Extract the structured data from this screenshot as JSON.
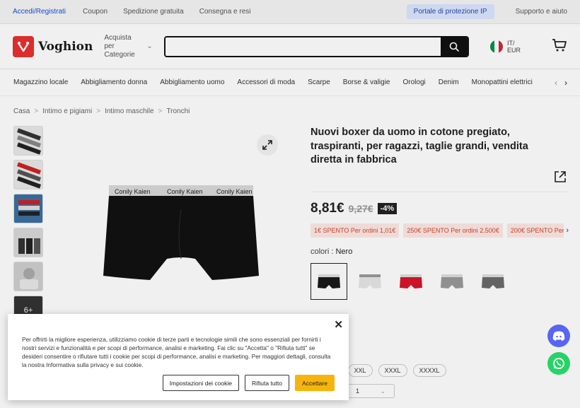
{
  "topbar": {
    "login": "Accedi/Registrati",
    "links": [
      "Coupon",
      "Spedizione gratuita",
      "Consegna e resi"
    ],
    "portal": "Portale di protezione IP",
    "support": "Supporto e aiuto"
  },
  "header": {
    "logo": "Voghion",
    "categories_line1": "Acquista per",
    "categories_line2": "Categorie",
    "search_placeholder": "",
    "lang_line1": "IT/",
    "lang_line2": "EUR"
  },
  "nav": [
    "Magazzino locale",
    "Abbigliamento donna",
    "Abbigliamento uomo",
    "Accessori di moda",
    "Scarpe",
    "Borse & valigie",
    "Orologi",
    "Denim",
    "Monopattini elettrici"
  ],
  "breadcrumb": [
    "Casa",
    "Intimo e pigiami",
    "Intimo maschile",
    "Tronchi"
  ],
  "gallery": {
    "more_label": "6+",
    "waistband_text": "Conily Kaien"
  },
  "product": {
    "title": "Nuovi boxer da uomo in cotone pregiato, traspiranti, per ragazzi, taglie grandi, vendita diretta in fabbrica",
    "price": "8,81€",
    "old_price": "9,27€",
    "discount": "-4%",
    "coupons": [
      "1€ SPENTO Per ordini 1,01€",
      "250€ SPENTO Per ordini 2.500€",
      "200€ SPENTO Per ordini"
    ],
    "color_label": "colori : ",
    "color_value": "Nero",
    "sizes": [
      "XXL",
      "XXXL",
      "XXXXL"
    ],
    "quantity": "1"
  },
  "colors": {
    "brand": "#e8312f",
    "accept": "#f6b40d",
    "login_link": "#1a4fd6",
    "swatches": [
      "#1a1a1a",
      "#e6e6e6",
      "#d8162a",
      "#9a9a9a",
      "#6b6b6b"
    ]
  },
  "cookie": {
    "text": "Per offrirti la migliore esperienza, utilizziamo cookie di terze parti e tecnologie simili che sono essenziali per fornirti i nostri servizi e funzionalità e per scopi di performance, analisi e marketing. Fai clic su \"Accetta\" o \"Rifiuta tutti\" se desideri consentire o rifiutare tutti i cookie per scopi di performance, analisi e marketing. Per maggiori dettagli, consulta la nostra Informativa sulla privacy e sui cookie.",
    "settings_button": "Impostazioni dei cookie",
    "reject_button": "Rifiuta tutto",
    "accept_button": "Accettare",
    "close_icon": "close-icon"
  }
}
